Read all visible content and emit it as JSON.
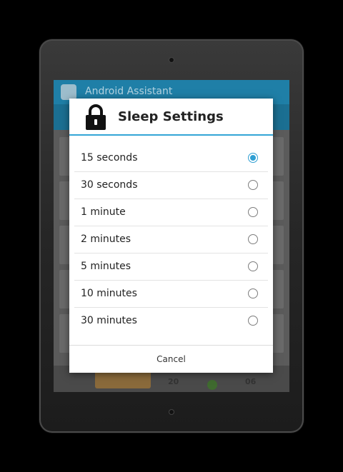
{
  "background_app": {
    "title": "Android Assistant",
    "date_number": "20",
    "time_number": "06"
  },
  "dialog": {
    "title": "Sleep Settings",
    "header_icon": "lock-icon",
    "options": [
      {
        "label": "15 seconds",
        "selected": true
      },
      {
        "label": "30 seconds",
        "selected": false
      },
      {
        "label": "1 minute",
        "selected": false
      },
      {
        "label": "2 minutes",
        "selected": false
      },
      {
        "label": "5 minutes",
        "selected": false
      },
      {
        "label": "10 minutes",
        "selected": false
      },
      {
        "label": "30 minutes",
        "selected": false
      }
    ],
    "cancel_label": "Cancel"
  },
  "colors": {
    "accent": "#33a5d6",
    "app_bar": "#1f7fa7",
    "radio_selected": "#2f9fd3"
  }
}
